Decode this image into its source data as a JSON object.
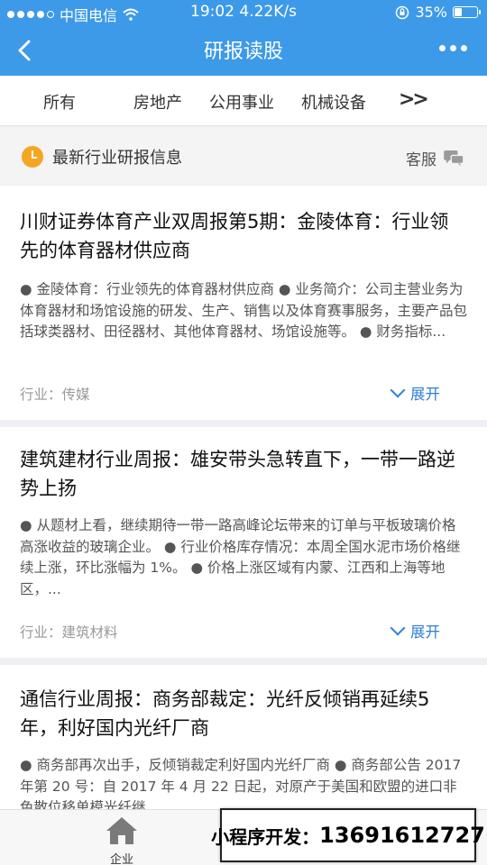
{
  "status_bar": {
    "carrier": "中国电信",
    "time_speed": "19:02 4.22K/s",
    "battery_text": "35%",
    "battery_level": 0.35
  },
  "nav": {
    "title": "研报读股",
    "back_icon": "chevron-left-icon",
    "more_icon": "ellipsis-icon"
  },
  "tabs": [
    "所有",
    "房地产",
    "公用事业",
    "机械设备"
  ],
  "tabs_more": ">>",
  "section": {
    "title": "最新行业研报信息",
    "service_label": "客服",
    "title_icon": "clock-icon",
    "service_icon": "chat-icon"
  },
  "cards": [
    {
      "title": "川财证券体育产业双周报第5期：金陵体育：行业领先的体育器材供应商",
      "body": "● 金陵体育：行业领先的体育器材供应商 ● 业务简介：公司主营业务为体育器材和场馆设施的研发、生产、销售以及体育赛事服务，主要产品包括球类器材、田径器材、其他体育器材、场馆设施等。 ● 财务指标...",
      "industry": "行业：传媒",
      "expand_label": "展开"
    },
    {
      "title": "建筑建材行业周报：雄安带头急转直下，一带一路逆势上扬",
      "body": "● 从题材上看，继续期待一带一路高峰论坛带来的订单与平板玻璃价格高涨收益的玻璃企业。 ● 行业价格库存情况：本周全国水泥市场价格继续上涨，环比涨幅为 1%。 ● 价格上涨区域有内蒙、江西和上海等地区，...",
      "industry": "行业：建筑材料",
      "expand_label": "展开"
    },
    {
      "title": "通信行业周报：商务部裁定：光纤反倾销再延续5年，利好国内光纤厂商",
      "body": "● 商务部再次出手，反倾销裁定利好国内光纤厂商 ● 商务部公告 2017 年第 20 号：自 2017 年 4 月 22 日起，对原产于美国和欧盟的进口非色散位移单模光纤继..."
    }
  ],
  "tabbar": {
    "items": [
      {
        "label": "企业",
        "icon": "house-icon"
      }
    ]
  },
  "ad": {
    "label": "小程序开发：",
    "phone": "13691612727"
  },
  "colors": {
    "header_blue": "#3d9ae8",
    "accent_blue": "#2f7fd4",
    "clock_orange": "#f5a623"
  }
}
